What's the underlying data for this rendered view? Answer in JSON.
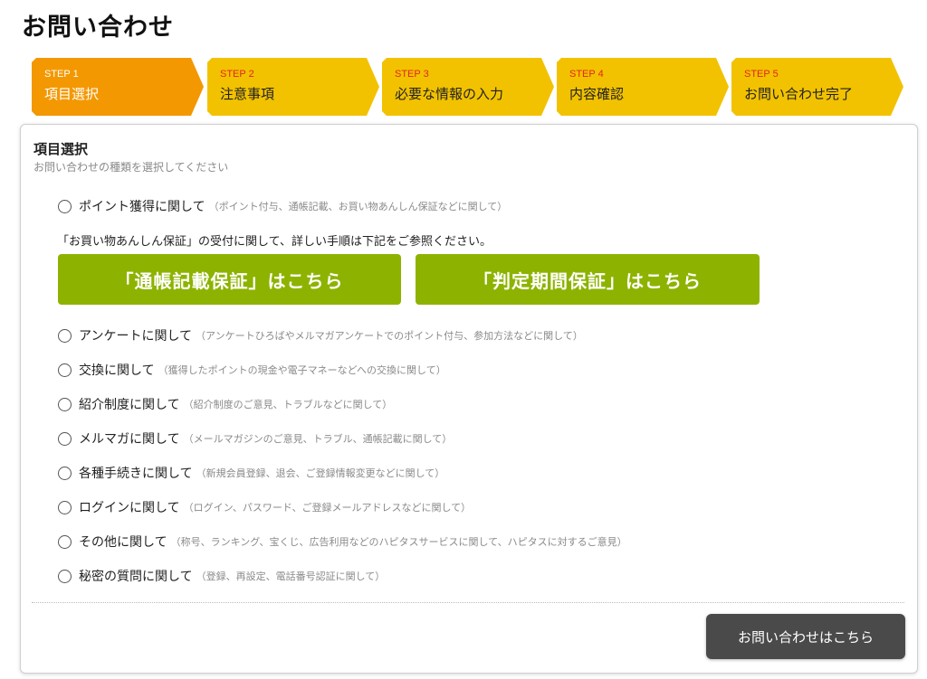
{
  "page": {
    "title": "お問い合わせ"
  },
  "steps": [
    {
      "num": "STEP 1",
      "name": "項目選択",
      "active": true
    },
    {
      "num": "STEP 2",
      "name": "注意事項",
      "active": false
    },
    {
      "num": "STEP 3",
      "name": "必要な情報の入力",
      "active": false
    },
    {
      "num": "STEP 4",
      "name": "内容確認",
      "active": false
    },
    {
      "num": "STEP 5",
      "name": "お問い合わせ完了",
      "active": false
    }
  ],
  "colors": {
    "active_step": "#f39800",
    "inactive_step": "#f2c200",
    "green_button": "#8db300",
    "submit_button": "#4a4a4a",
    "step_number": "#e0261b"
  },
  "section": {
    "title": "項目選択",
    "subtitle": "お問い合わせの種類を選択してください"
  },
  "options": [
    {
      "label": "ポイント獲得に関して",
      "desc": "（ポイント付与、通帳記載、お買い物あんしん保証などに関して）",
      "selected": false
    },
    {
      "label": "アンケートに関して",
      "desc": "（アンケートひろばやメルマガアンケートでのポイント付与、参加方法などに関して）",
      "selected": false
    },
    {
      "label": "交換に関して",
      "desc": "（獲得したポイントの現金や電子マネーなどへの交換に関して）",
      "selected": false
    },
    {
      "label": "紹介制度に関して",
      "desc": "（紹介制度のご意見、トラブルなどに関して）",
      "selected": false
    },
    {
      "label": "メルマガに関して",
      "desc": "（メールマガジンのご意見、トラブル、通帳記載に関して）",
      "selected": false
    },
    {
      "label": "各種手続きに関して",
      "desc": "（新規会員登録、退会、ご登録情報変更などに関して）",
      "selected": false
    },
    {
      "label": "ログインに関して",
      "desc": "（ログイン、パスワード、ご登録メールアドレスなどに関して）",
      "selected": false
    },
    {
      "label": "その他に関して",
      "desc": "（称号、ランキング、宝くじ、広告利用などのハピタスサービスに関して、ハピタスに対するご意見）",
      "selected": false
    },
    {
      "label": "秘密の質問に関して",
      "desc": "（登録、再設定、電話番号認証に関して）",
      "selected": false
    }
  ],
  "notice": "「お買い物あんしん保証」の受付に関して、詳しい手順は下記をご参照ください。",
  "buttons": {
    "passbook_guarantee": "「通帳記載保証」はこちら",
    "judgment_guarantee": "「判定期間保証」はこちら",
    "submit": "お問い合わせはこちら"
  }
}
